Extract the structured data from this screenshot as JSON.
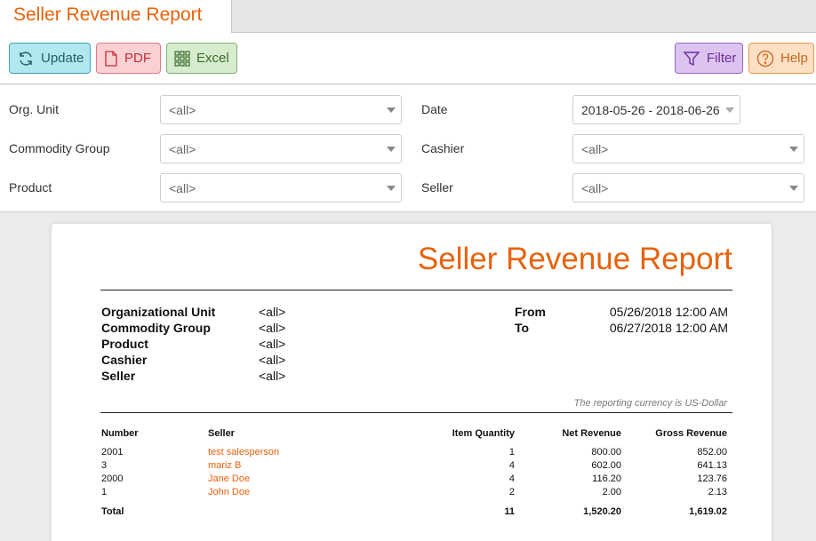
{
  "tab": {
    "title": "Seller Revenue Report"
  },
  "toolbar": {
    "update_label": "Update",
    "pdf_label": "PDF",
    "excel_label": "Excel",
    "filter_label": "Filter",
    "help_label": "Help"
  },
  "filters": {
    "org_unit": {
      "label": "Org. Unit",
      "value": "<all>"
    },
    "commodity_group": {
      "label": "Commodity Group",
      "value": "<all>"
    },
    "product": {
      "label": "Product",
      "value": "<all>"
    },
    "date": {
      "label": "Date",
      "value": "2018-05-26 - 2018-06-26"
    },
    "cashier": {
      "label": "Cashier",
      "value": "<all>"
    },
    "seller": {
      "label": "Seller",
      "value": "<all>"
    }
  },
  "report": {
    "title": "Seller Revenue Report",
    "meta": [
      {
        "label": "Organizational Unit",
        "value": "<all>"
      },
      {
        "label": "Commodity Group",
        "value": "<all>"
      },
      {
        "label": "Product",
        "value": "<all>"
      },
      {
        "label": "Cashier",
        "value": "<all>"
      },
      {
        "label": "Seller",
        "value": "<all>"
      }
    ],
    "from_label": "From",
    "from_value": "05/26/2018 12:00 AM",
    "to_label": "To",
    "to_value": "06/27/2018 12:00 AM",
    "currency_note": "The reporting currency is US-Dollar",
    "columns": [
      "Number",
      "Seller",
      "Item Quantity",
      "Net Revenue",
      "Gross Revenue"
    ],
    "rows": [
      {
        "number": "2001",
        "seller": "test salesperson",
        "qty": "1",
        "net": "800.00",
        "gross": "852.00"
      },
      {
        "number": "3",
        "seller": "mariz B",
        "qty": "4",
        "net": "602.00",
        "gross": "641.13"
      },
      {
        "number": "2000",
        "seller": "Jane Doe",
        "qty": "4",
        "net": "116.20",
        "gross": "123.76"
      },
      {
        "number": "1",
        "seller": "John Doe",
        "qty": "2",
        "net": "2.00",
        "gross": "2.13"
      }
    ],
    "total": {
      "label": "Total",
      "qty": "11",
      "net": "1,520.20",
      "gross": "1,619.02"
    }
  }
}
